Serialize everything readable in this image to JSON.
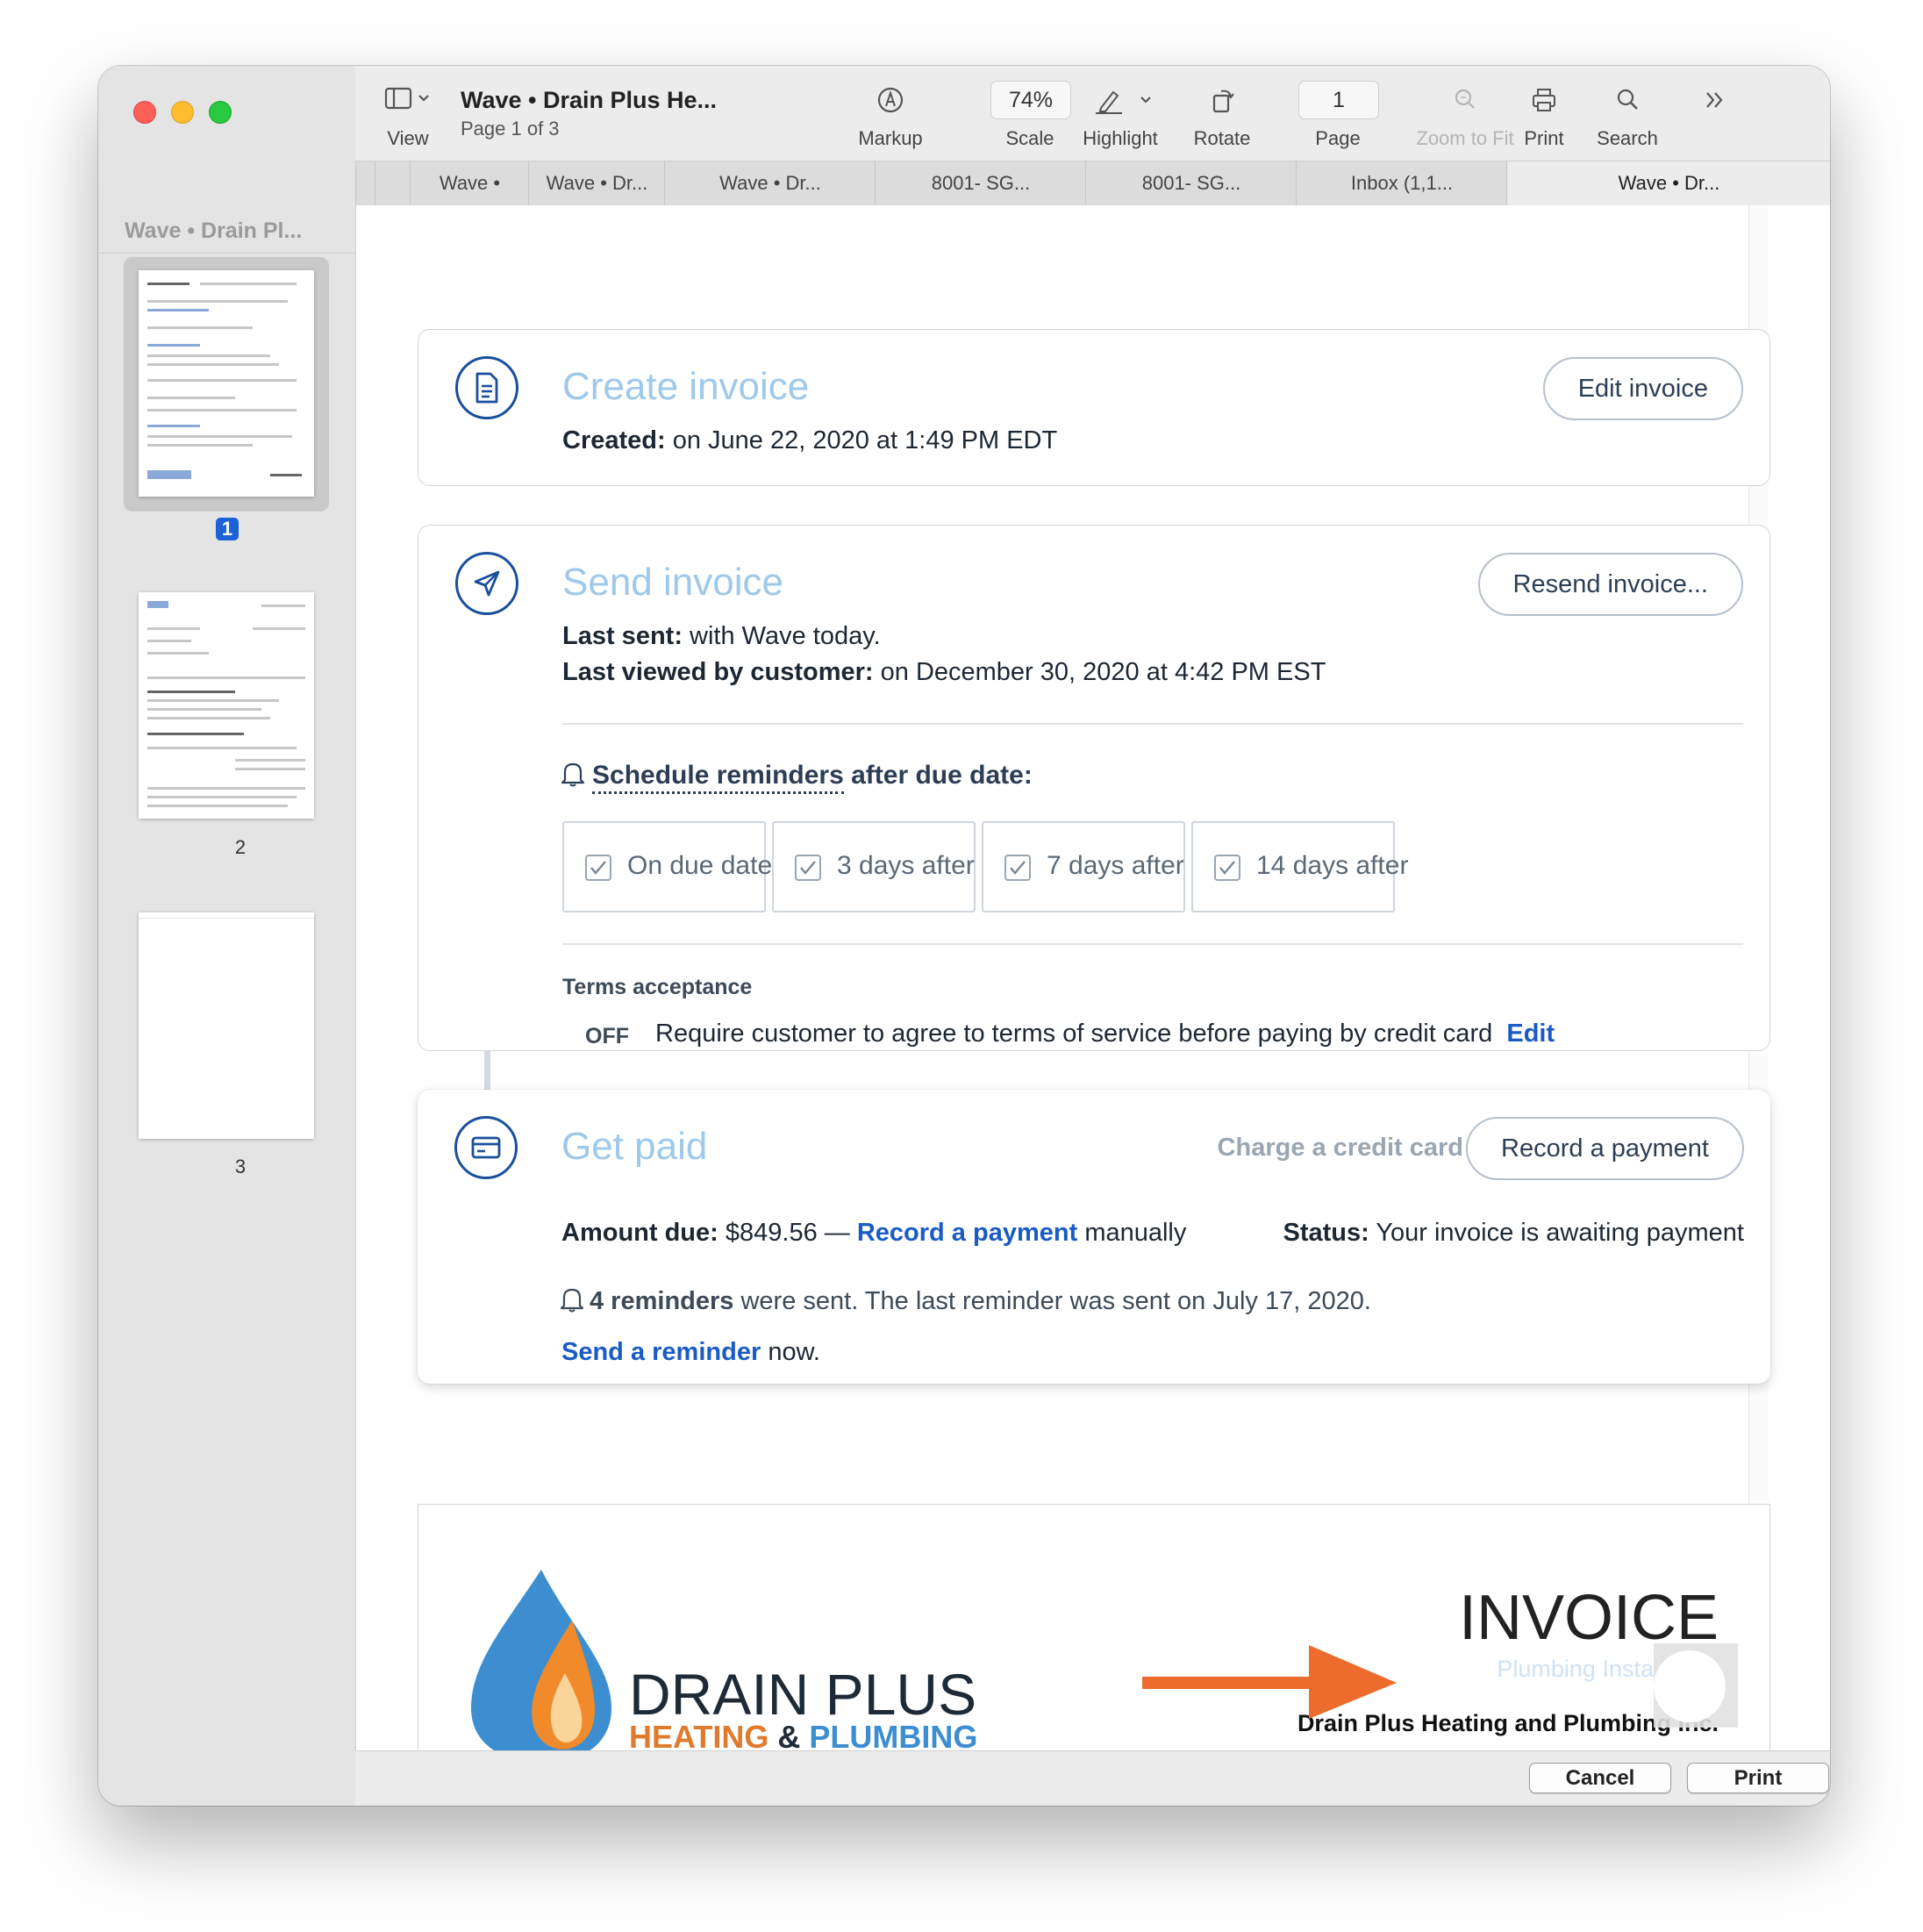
{
  "window": {
    "doc_title": "Wave • Drain Plus He...",
    "page_info": "Page 1 of 3"
  },
  "sidebar": {
    "title": "Wave • Drain Pl...",
    "pages": [
      "1",
      "2",
      "3"
    ],
    "selected_page": "1"
  },
  "toolbar": {
    "view_label": "View",
    "markup_label": "Markup",
    "scale_value": "74%",
    "scale_label": "Scale",
    "highlight_label": "Highlight",
    "rotate_label": "Rotate",
    "page_value": "1",
    "page_label": "Page",
    "zoom_label": "Zoom to Fit",
    "print_label": "Print",
    "search_label": "Search"
  },
  "tabs": [
    "Wave •",
    "Wave • Dr...",
    "Wave • Dr...",
    "8001- SG...",
    "8001- SG...",
    "Inbox (1,1...",
    "Wave • Dr..."
  ],
  "create": {
    "title": "Create invoice",
    "button": "Edit invoice",
    "created_label": "Created:",
    "created_value": "on June 22, 2020 at 1:49 PM EDT"
  },
  "send": {
    "title": "Send invoice",
    "button": "Resend invoice...",
    "last_sent_label": "Last sent:",
    "last_sent_value": "with Wave today.",
    "last_viewed_label": "Last viewed by customer:",
    "last_viewed_value": "on December 30, 2020 at 4:42 PM EST",
    "schedule_link": "Schedule reminders",
    "schedule_rest": "after due date:",
    "reminders": [
      "On due date",
      "3 days after",
      "7 days after",
      "14 days after"
    ],
    "terms_heading": "Terms acceptance",
    "terms_state": "OFF",
    "terms_text": "Require customer to agree to terms of service before paying by credit card",
    "terms_edit": "Edit"
  },
  "getpaid": {
    "title": "Get paid",
    "charge_label": "Charge a credit card",
    "button": "Record a payment",
    "amount_label": "Amount due:",
    "amount_value": "$849.56 —",
    "record_link": "Record a payment",
    "manually": "manually",
    "status_label": "Status:",
    "status_value": "Your invoice is awaiting payment",
    "reminders_count": "4 reminders",
    "reminders_rest": "were sent. The last reminder was sent on July 17, 2020.",
    "send_reminder_link": "Send a reminder",
    "send_reminder_rest": "now."
  },
  "preview": {
    "brand_line1": "DRAIN PLUS",
    "brand_heating": "HEATING",
    "brand_amp": "&",
    "brand_plumbing": "PLUMBING",
    "invoice_heading": "INVOICE",
    "faded_text": "Plumbing Install",
    "company": "Drain Plus Heating and Plumbing Inc."
  },
  "dialog": {
    "cancel": "Cancel",
    "print": "Print"
  },
  "colors": {
    "accent": "#1a5bc4",
    "step_title": "#9fc9ea",
    "arrow": "#ec6b2d"
  }
}
